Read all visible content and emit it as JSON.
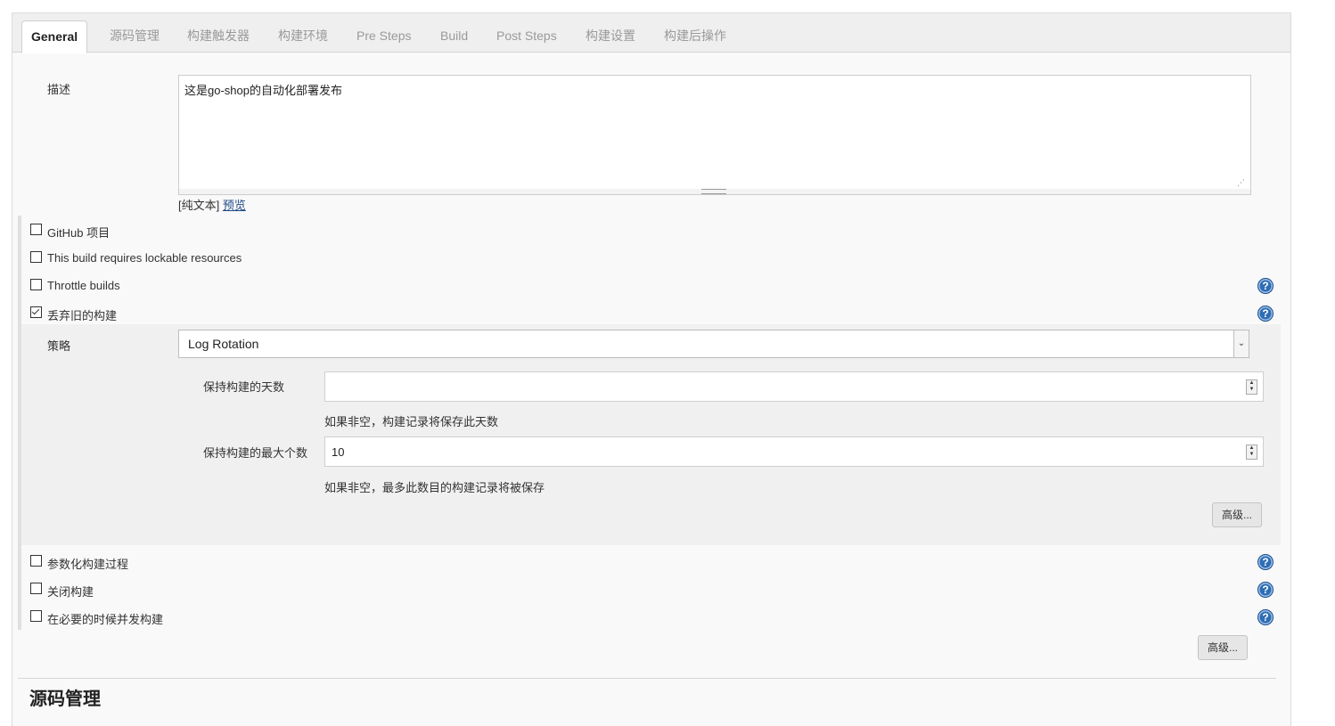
{
  "tabs": [
    {
      "label": "General",
      "active": true
    },
    {
      "label": "源码管理"
    },
    {
      "label": "构建触发器"
    },
    {
      "label": "构建环境"
    },
    {
      "label": "Pre Steps"
    },
    {
      "label": "Build"
    },
    {
      "label": "Post Steps"
    },
    {
      "label": "构建设置"
    },
    {
      "label": "构建后操作"
    }
  ],
  "description": {
    "label": "描述",
    "value": "这是go-shop的自动化部署发布",
    "plain_text_label": "[纯文本]",
    "preview_link": "预览"
  },
  "options": {
    "github_project": {
      "label": "GitHub 项目",
      "checked": false
    },
    "lockable_resources": {
      "label": "This build requires lockable resources",
      "checked": false
    },
    "throttle_builds": {
      "label": "Throttle builds",
      "checked": false
    },
    "discard_old_builds": {
      "label": "丢弃旧的构建",
      "checked": true
    },
    "parameterized": {
      "label": "参数化构建过程",
      "checked": false
    },
    "disable_build": {
      "label": "关闭构建",
      "checked": false
    },
    "concurrent_builds": {
      "label": "在必要的时候并发构建",
      "checked": false
    }
  },
  "strategy": {
    "label": "策略",
    "selected": "Log Rotation",
    "days_to_keep": {
      "label": "保持构建的天数",
      "value": "",
      "hint": "如果非空，构建记录将保存此天数"
    },
    "max_builds": {
      "label": "保持构建的最大个数",
      "value": "10",
      "hint": "如果非空，最多此数目的构建记录将被保存"
    },
    "advanced_button": "高级..."
  },
  "advanced_button": "高级...",
  "next_section_title": "源码管理",
  "colors": {
    "help_icon": "#2f6db5",
    "tab_bar": "#efefef",
    "panel": "#f9f9f9"
  }
}
